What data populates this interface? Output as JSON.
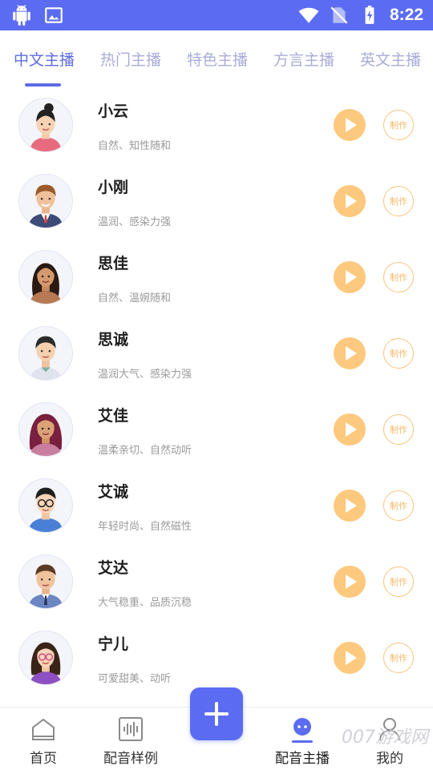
{
  "status_bar": {
    "time": "8:22",
    "icons_left": [
      "android-icon",
      "image-icon"
    ],
    "icons_right": [
      "wifi-icon",
      "no-sim-icon",
      "battery-charging-icon"
    ]
  },
  "tabs": [
    {
      "label": "中文主播",
      "active": true
    },
    {
      "label": "热门主播",
      "active": false
    },
    {
      "label": "特色主播",
      "active": false
    },
    {
      "label": "方言主播",
      "active": false
    },
    {
      "label": "英文主播",
      "active": false
    }
  ],
  "anchors": [
    {
      "name": "小云",
      "desc": "自然、知性随和",
      "make_label": "制作",
      "avatar": "female-bun"
    },
    {
      "name": "小刚",
      "desc": "温润、感染力强",
      "make_label": "制作",
      "avatar": "male-suit"
    },
    {
      "name": "思佳",
      "desc": "自然、温婉随和",
      "make_label": "制作",
      "avatar": "female-long-hair"
    },
    {
      "name": "思诚",
      "desc": "温润大气、感染力强",
      "make_label": "制作",
      "avatar": "male-young"
    },
    {
      "name": "艾佳",
      "desc": "温柔亲切、自然动听",
      "make_label": "制作",
      "avatar": "female-curly"
    },
    {
      "name": "艾诚",
      "desc": "年轻时尚、自然磁性",
      "make_label": "制作",
      "avatar": "male-glasses"
    },
    {
      "name": "艾达",
      "desc": "大气稳重、品质沉稳",
      "make_label": "制作",
      "avatar": "male-tie"
    },
    {
      "name": "宁儿",
      "desc": "可爱甜美、动听",
      "make_label": "制作",
      "avatar": "female-glasses"
    }
  ],
  "bottom_nav": {
    "items": [
      {
        "label": "首页",
        "icon": "home-icon",
        "active": false
      },
      {
        "label": "配音样例",
        "icon": "waveform-icon",
        "active": false
      },
      {
        "label": "配音主播",
        "icon": "anchor-face-icon",
        "active": true
      },
      {
        "label": "我的",
        "icon": "profile-icon",
        "active": false
      }
    ],
    "fab_icon": "plus-icon"
  },
  "watermark": "007游戏网",
  "colors": {
    "primary": "#5b6cf2",
    "tab_inactive": "#a9acd9",
    "play": "#fdc97e",
    "make_border": "#f8c57e"
  }
}
